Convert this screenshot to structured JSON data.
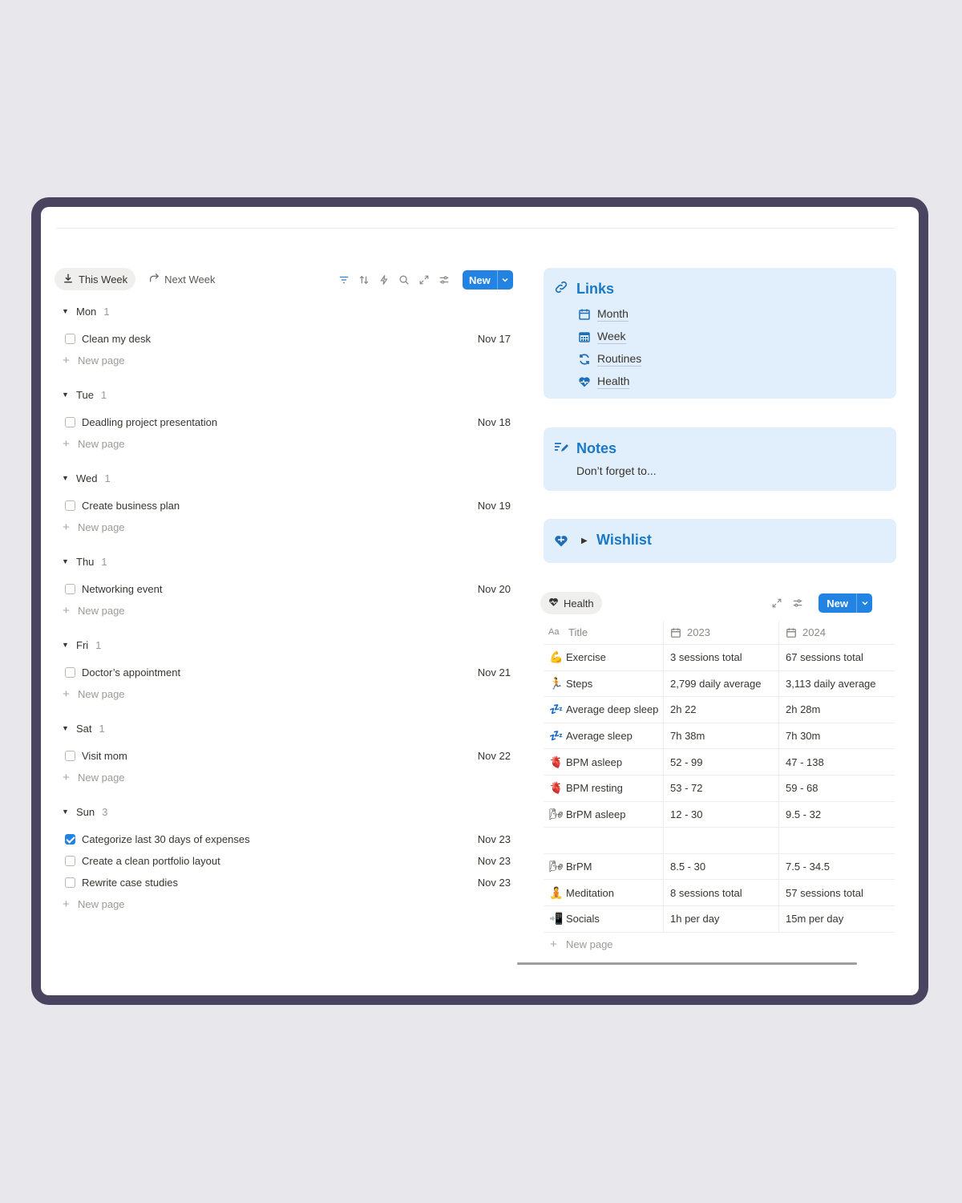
{
  "tabs": [
    {
      "label": "This Week",
      "icon": "download-icon"
    },
    {
      "label": "Next Week",
      "icon": "arrow-forward-icon"
    }
  ],
  "toolbar": {
    "new_label": "New"
  },
  "days": [
    {
      "name": "Mon",
      "count": "1",
      "tasks": [
        {
          "title": "Clean my desk",
          "date": "Nov 17",
          "done": false
        }
      ]
    },
    {
      "name": "Tue",
      "count": "1",
      "tasks": [
        {
          "title": "Deadling project presentation",
          "date": "Nov 18",
          "done": false
        }
      ]
    },
    {
      "name": "Wed",
      "count": "1",
      "tasks": [
        {
          "title": "Create business plan",
          "date": "Nov 19",
          "done": false
        }
      ]
    },
    {
      "name": "Thu",
      "count": "1",
      "tasks": [
        {
          "title": "Networking event",
          "date": "Nov 20",
          "done": false
        }
      ]
    },
    {
      "name": "Fri",
      "count": "1",
      "tasks": [
        {
          "title": "Doctor’s appointment",
          "date": "Nov 21",
          "done": false
        }
      ]
    },
    {
      "name": "Sat",
      "count": "1",
      "tasks": [
        {
          "title": "Visit mom",
          "date": "Nov 22",
          "done": false
        }
      ]
    },
    {
      "name": "Sun",
      "count": "3",
      "tasks": [
        {
          "title": "Categorize last 30 days of expenses",
          "date": "Nov 23",
          "done": true
        },
        {
          "title": "Create a clean portfolio layout",
          "date": "Nov 23",
          "done": false
        },
        {
          "title": "Rewrite case studies",
          "date": "Nov 23",
          "done": false
        }
      ]
    }
  ],
  "new_page_label": "New page",
  "links": {
    "title": "Links",
    "items": [
      {
        "label": "Month",
        "icon": "calendar-icon"
      },
      {
        "label": "Week",
        "icon": "calendar-grid-icon"
      },
      {
        "label": "Routines",
        "icon": "refresh-icon"
      },
      {
        "label": "Health",
        "icon": "heart-pulse-icon"
      }
    ]
  },
  "notes": {
    "title": "Notes",
    "text": "Don’t forget to..."
  },
  "wishlist": {
    "title": "Wishlist"
  },
  "health": {
    "tab_label": "Health",
    "new_label": "New",
    "columns": [
      "Title",
      "2023",
      "2024"
    ],
    "rows": [
      {
        "emoji": "💪",
        "title": "Exercise",
        "y2023": "3 sessions total",
        "y2024": "67 sessions total"
      },
      {
        "emoji": "🏃",
        "title": "Steps",
        "y2023": "2,799 daily average",
        "y2024": "3,113 daily average"
      },
      {
        "emoji": "💤",
        "title": "Average deep sleep",
        "y2023": "2h 22",
        "y2024": "2h 28m"
      },
      {
        "emoji": "💤",
        "title": "Average sleep",
        "y2023": "7h 38m",
        "y2024": "7h 30m"
      },
      {
        "emoji": "🫀",
        "title": "BPM asleep",
        "y2023": "52 - 99",
        "y2024": "47 - 138"
      },
      {
        "emoji": "🫀",
        "title": "BPM resting",
        "y2023": "53 - 72",
        "y2024": "59 - 68"
      },
      {
        "emoji": "🌬",
        "title": "BrPM asleep",
        "y2023": "12 - 30",
        "y2024": "9.5 - 32"
      },
      {
        "emoji": "",
        "title": "",
        "y2023": "",
        "y2024": ""
      },
      {
        "emoji": "🌬",
        "title": "BrPM",
        "y2023": "8.5 - 30",
        "y2024": "7.5 - 34.5"
      },
      {
        "emoji": "🧘",
        "title": "Meditation",
        "y2023": "8 sessions total",
        "y2024": "57 sessions total"
      },
      {
        "emoji": "📲",
        "title": "Socials",
        "y2023": "1h per day",
        "y2024": "15m per day"
      }
    ]
  },
  "colors": {
    "accent": "#2383e2",
    "callout_bg": "#e1eefb",
    "callout_title": "#1a79c6",
    "frame": "#4b4460"
  }
}
